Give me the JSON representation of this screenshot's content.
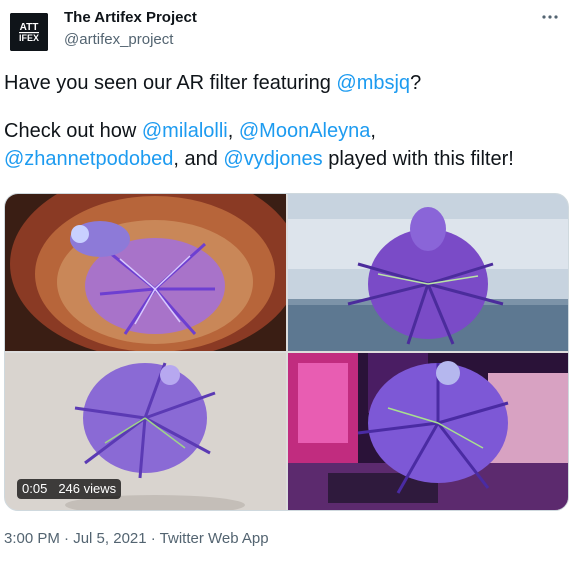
{
  "tweet": {
    "display_name": "The Artifex Project",
    "handle": "@artifex_project",
    "avatar_text_top": "ATT",
    "avatar_text_bottom": "IFEX",
    "more_icon": "ellipsis-icon",
    "line1": {
      "before": "Have you seen our AR filter featuring ",
      "mention": "@mbsjq",
      "after": "?"
    },
    "line2": {
      "before": "Check out how ",
      "mention1": "@milalolli",
      "sep1": ", ",
      "mention2": "@MoonAleyna",
      "sep2": ",",
      "mention3": "@zhannetpodobed",
      "sep3": ", and ",
      "mention4": "@vydjones",
      "after": " played with this filter!"
    },
    "video": {
      "time": "0:05",
      "views": "246 views"
    },
    "meta": {
      "time": "3:00 PM",
      "dot1": " · ",
      "date": "Jul 5, 2021",
      "dot2": " · ",
      "source": "Twitter Web App"
    }
  },
  "colors": {
    "link": "#1d9bf0",
    "text": "#0f1419",
    "muted": "#536471",
    "border": "#cfd9de"
  }
}
